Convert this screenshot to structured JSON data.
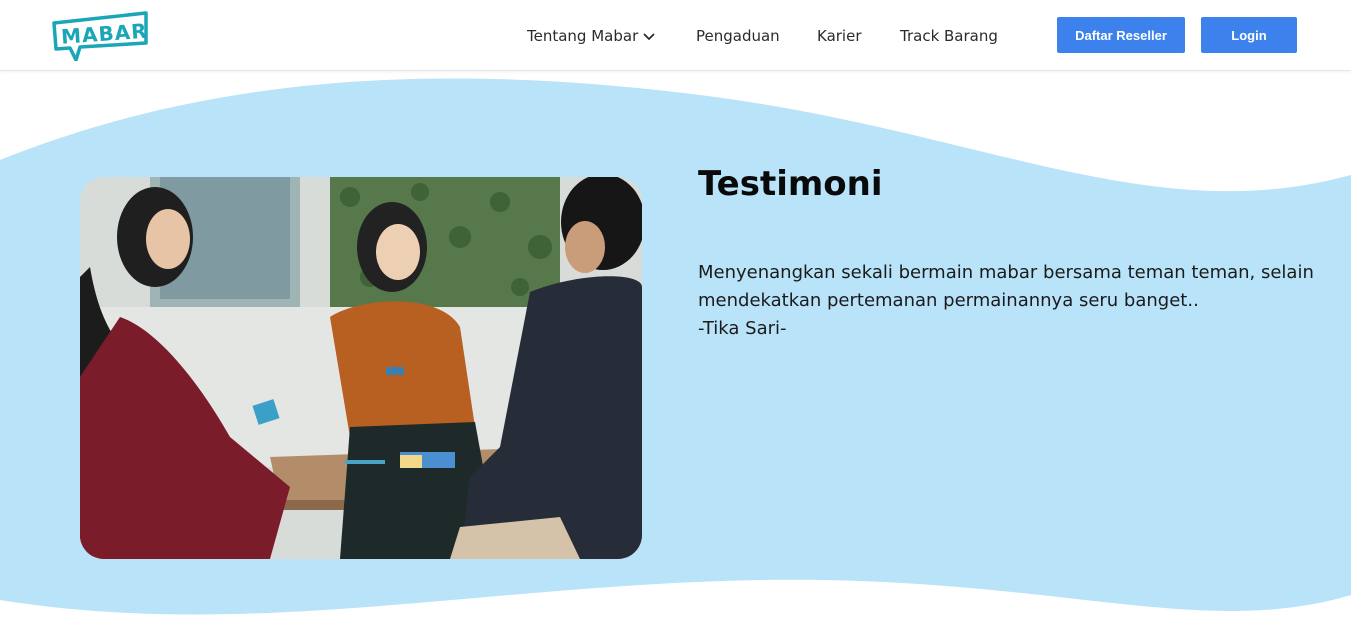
{
  "header": {
    "logo_text": "MABAR",
    "nav": [
      {
        "label": "Tentang Mabar",
        "has_dropdown": true
      },
      {
        "label": "Pengaduan"
      },
      {
        "label": "Karier"
      },
      {
        "label": "Track Barang"
      }
    ],
    "buttons": {
      "reseller": "Daftar Reseller",
      "login": "Login"
    }
  },
  "testimonial": {
    "title": "Testimoni",
    "lines": [
      "Menyenangkan sekali bermain mabar bersama teman teman, selain",
      "mendekatkan pertemanan permainannya seru banget..",
      "-Tika Sari-"
    ]
  },
  "colors": {
    "brand_teal": "#1aa6b7",
    "button_blue": "#3d82ec",
    "wave_blue": "#b8e3f8"
  }
}
